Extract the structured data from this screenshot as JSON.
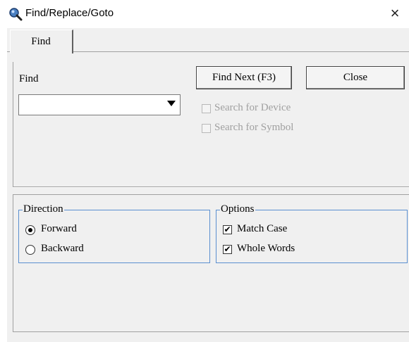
{
  "window": {
    "title": "Find/Replace/Goto",
    "close_glyph": "×"
  },
  "tabs": [
    {
      "label": "Find",
      "active": true
    }
  ],
  "find": {
    "label": "Find",
    "value": "",
    "find_next_label": "Find Next (F3)",
    "close_label": "Close",
    "search_device": {
      "label": "Search for Device",
      "checked": false,
      "enabled": false
    },
    "search_symbol": {
      "label": "Search for Symbol",
      "checked": false,
      "enabled": false
    }
  },
  "direction": {
    "title": "Direction",
    "forward": {
      "label": "Forward",
      "selected": true
    },
    "backward": {
      "label": "Backward",
      "selected": false
    }
  },
  "options": {
    "title": "Options",
    "match_case": {
      "label": "Match Case",
      "checked": true
    },
    "whole_words": {
      "label": "Whole Words",
      "checked": true
    }
  },
  "colors": {
    "groupbox_border": "#5a8fd0",
    "dialog_bg": "#f0f0f0"
  }
}
